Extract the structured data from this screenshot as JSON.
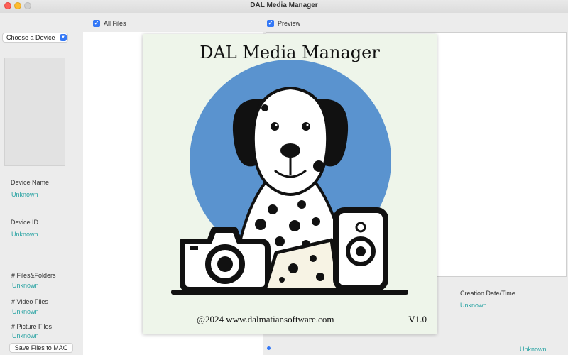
{
  "window": {
    "title": "DAL Media Manager"
  },
  "top_bar": {
    "all_files_label": "All Files",
    "all_files_checked": true,
    "preview_label": "Preview",
    "preview_checked": true
  },
  "sidebar": {
    "device_select_value": "Choose a Device",
    "device_name_label": "Device Name",
    "device_name_value": "Unknown",
    "device_id_label": "Device ID",
    "device_id_value": "Unknown",
    "files_folders_label": "# Files&Folders",
    "files_folders_value": "Unknown",
    "video_files_label": "# Video Files",
    "video_files_value": "Unknown",
    "picture_files_label": "# Picture Files",
    "picture_files_value": "Unknown",
    "save_button_label": "Save Files to MAC"
  },
  "details": {
    "creation_label": "Creation Date/Time",
    "creation_value": "Unknown",
    "bottom_value": "Unknown"
  },
  "splash": {
    "title": "DAL Media Manager",
    "footer": "@2024 www.dalmatiansoftware.com",
    "version": "V1.0"
  },
  "colors": {
    "accent": "#3478f6",
    "value_text": "#29a3a3",
    "splash_circle": "#5a93cf"
  },
  "icons": [
    "checkbox-icon",
    "chevron-down-icon",
    "dalmatian-dog-logo",
    "camera-icon",
    "phone-icon"
  ]
}
